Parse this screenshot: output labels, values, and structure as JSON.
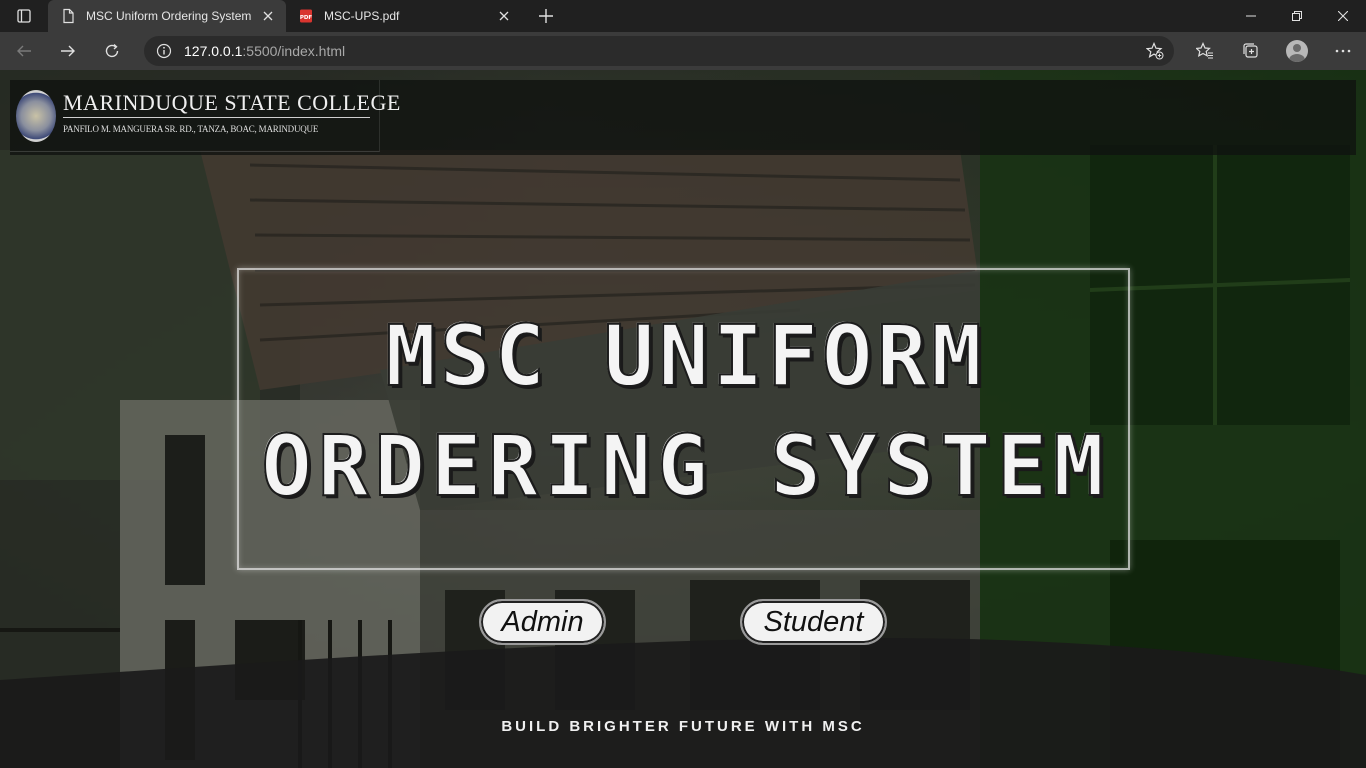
{
  "browser": {
    "tabs": [
      {
        "title": "MSC Uniform Ordering System",
        "active": true
      },
      {
        "title": "MSC-UPS.pdf",
        "active": false
      }
    ],
    "address": {
      "host": "127.0.0.1",
      "path": ":5500/index.html"
    }
  },
  "header": {
    "college_name": "MARINDUQUE STATE COLLEGE",
    "address": "PANFILO M. MANGUERA SR. RD., TANZA, BOAC, MARINDUQUE"
  },
  "hero": {
    "line1": "MSC UNIFORM",
    "line2": "ORDERING SYSTEM"
  },
  "buttons": {
    "admin": "Admin",
    "student": "Student"
  },
  "footer": {
    "tagline": "BUILD BRIGHTER FUTURE WITH MSC"
  },
  "colors": {
    "chrome_dark": "#202020",
    "chrome_toolbar": "#3b3b3b",
    "header_overlay": "#0f120f",
    "button_bg": "#f2f2f2"
  }
}
